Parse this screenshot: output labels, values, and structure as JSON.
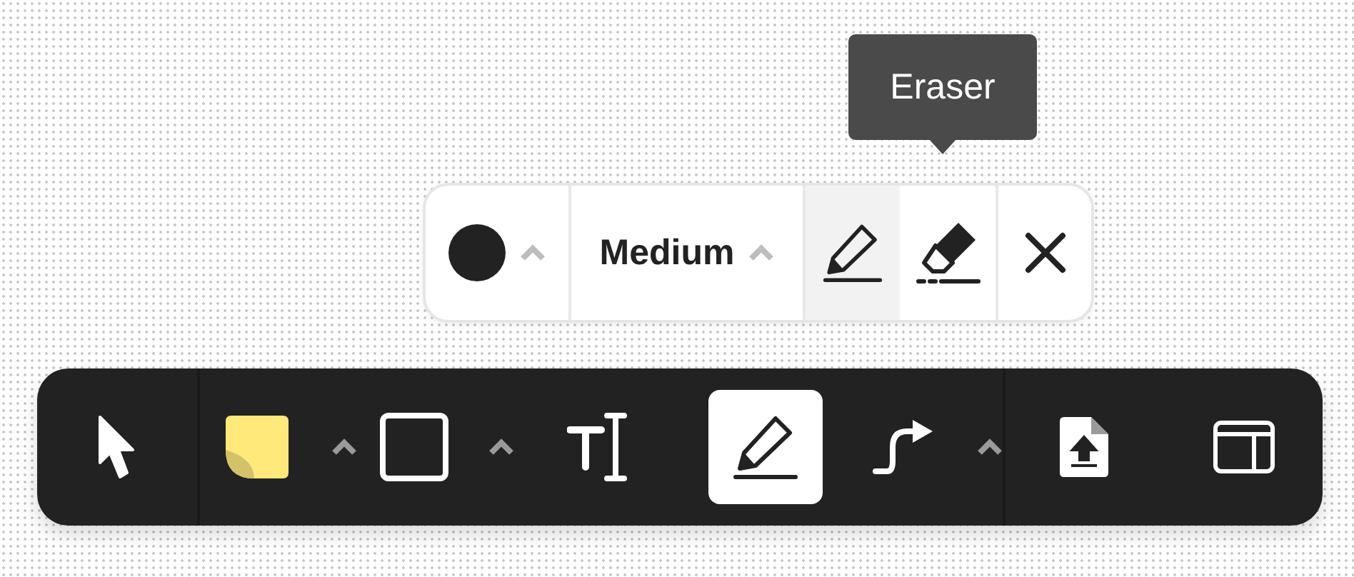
{
  "tooltip": {
    "text": "Eraser"
  },
  "pen_options": {
    "color": "#222222",
    "color_menu": true,
    "size": "Medium",
    "size_menu": true,
    "tools": [
      {
        "kind": "pen",
        "selected": true
      },
      {
        "kind": "eraser",
        "selected": false
      }
    ]
  },
  "toolbar": {
    "groups": [
      [
        {
          "kind": "select",
          "selected": false,
          "menu": false
        }
      ],
      [
        {
          "kind": "sticky",
          "selected": false,
          "menu": true
        },
        {
          "kind": "shape",
          "selected": false,
          "menu": true
        },
        {
          "kind": "text",
          "selected": false,
          "menu": false
        },
        {
          "kind": "pen",
          "selected": true,
          "menu": false
        },
        {
          "kind": "connector",
          "selected": false,
          "menu": true
        }
      ],
      [
        {
          "kind": "upload",
          "selected": false,
          "menu": false
        },
        {
          "kind": "layout",
          "selected": false,
          "menu": false
        }
      ]
    ]
  }
}
